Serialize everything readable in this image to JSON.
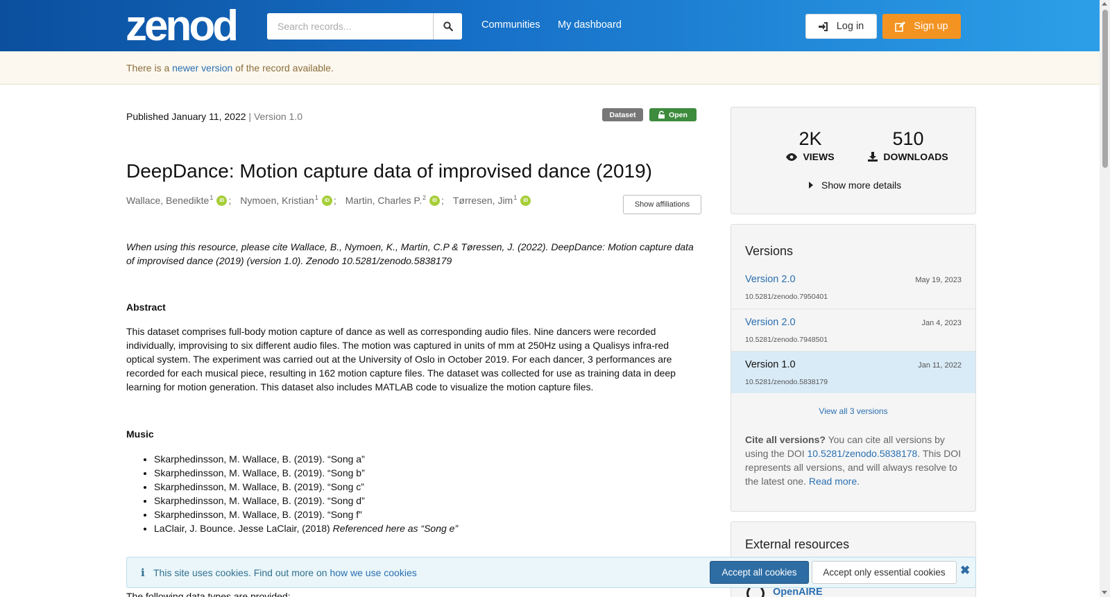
{
  "header": {
    "logo_text": "zenodo",
    "search_placeholder": "Search records...",
    "nav": [
      "Communities",
      "My dashboard"
    ],
    "login_label": "Log in",
    "signup_label": "Sign up"
  },
  "notice": {
    "prefix": "There is a ",
    "link": "newer version",
    "suffix": " of the record available."
  },
  "record": {
    "published": "Published January 11, 2022",
    "version": " | Version 1.0",
    "badge_type": "Dataset",
    "badge_access": "Open",
    "title": "DeepDance: Motion capture data of improvised dance (2019)",
    "authors": [
      {
        "name": "Wallace, Benedikte",
        "aff": "1"
      },
      {
        "name": "Nymoen, Kristian",
        "aff": "1"
      },
      {
        "name": "Martin, Charles P.",
        "aff": "2"
      },
      {
        "name": "Tørresen, Jim",
        "aff": "1"
      }
    ],
    "orcid_label": "iD",
    "show_affiliations": "Show affiliations",
    "cite_note": "When using this resource, please cite Wallace, B., Nymoen, K., Martin, C.P & Tøressen, J. (2022). DeepDance: Motion capture data of improvised dance (2019) (version 1.0). Zenodo 10.5281/zenodo.5838179",
    "abstract_heading": "Abstract",
    "abstract": "This dataset comprises full-body motion capture of dance as well as corresponding audio files. Nine dancers were recorded individually, improvising to six different audio files. The motion was captured in units of mm at 250Hz using a Qualisys infra-red optical system. The experiment was carried out at the University of Oslo in October 2019. For each dancer, 3 performances are recorded for each musical piece, resulting in 162 motion capture files. The dataset was collected for use as training data in deep learning for motion generation. This dataset also includes MATLAB code to visualize the motion capture files.",
    "music_heading": "Music",
    "music": [
      "Skarphedinsson, M. Wallace, B. (2019). “Song a”",
      "Skarphedinsson, M. Wallace, B. (2019). “Song b”",
      "Skarphedinsson, M. Wallace, B. (2019). “Song c”",
      "Skarphedinsson, M. Wallace, B. (2019). “Song d”",
      "Skarphedinsson, M. Wallace, B. (2019). “Song f”"
    ],
    "music_last_plain": "LaClair, J. Bounce. Jesse LaClair, (2018) ",
    "music_last_italic": "Referenced here as “Song e”",
    "cutoff_text": "The following data types are provided:"
  },
  "stats": {
    "views": "2K",
    "views_label": "VIEWS",
    "downloads": "510",
    "downloads_label": "DOWNLOADS",
    "more_details": "Show more details"
  },
  "versions": {
    "title": "Versions",
    "items": [
      {
        "name": "Version 2.0",
        "date": "May 19, 2023",
        "doi": "10.5281/zenodo.7950401"
      },
      {
        "name": "Version 2.0",
        "date": "Jan 4, 2023",
        "doi": "10.5281/zenodo.7948501"
      },
      {
        "name": "Version 1.0",
        "date": "Jan 11, 2022",
        "doi": "10.5281/zenodo.5838179"
      }
    ],
    "view_all": "View all 3 versions",
    "cite_all_bold": "Cite all versions?",
    "cite_all_text1": " You can cite all versions by using the DOI ",
    "cite_all_doi": "10.5281/zenodo.5838178",
    "cite_all_text2": ". This DOI represents all versions, and will always resolve to the latest one. ",
    "read_more": "Read more",
    "period": "."
  },
  "external": {
    "title": "External resources",
    "openaire": "OpenAIRE"
  },
  "cookie": {
    "icon": "i",
    "text": "This site uses cookies. Find out more on ",
    "link": "how we use cookies",
    "accept_all": "Accept all cookies",
    "accept_essential": "Accept only essential cookies"
  },
  "colors": {
    "header_start": "#0b4f9e",
    "header_end": "#2c9fe8",
    "signup": "#f39322",
    "link": "#2a6fb1",
    "open_badge": "#3d8b3d",
    "orcid": "#a6ce39"
  }
}
